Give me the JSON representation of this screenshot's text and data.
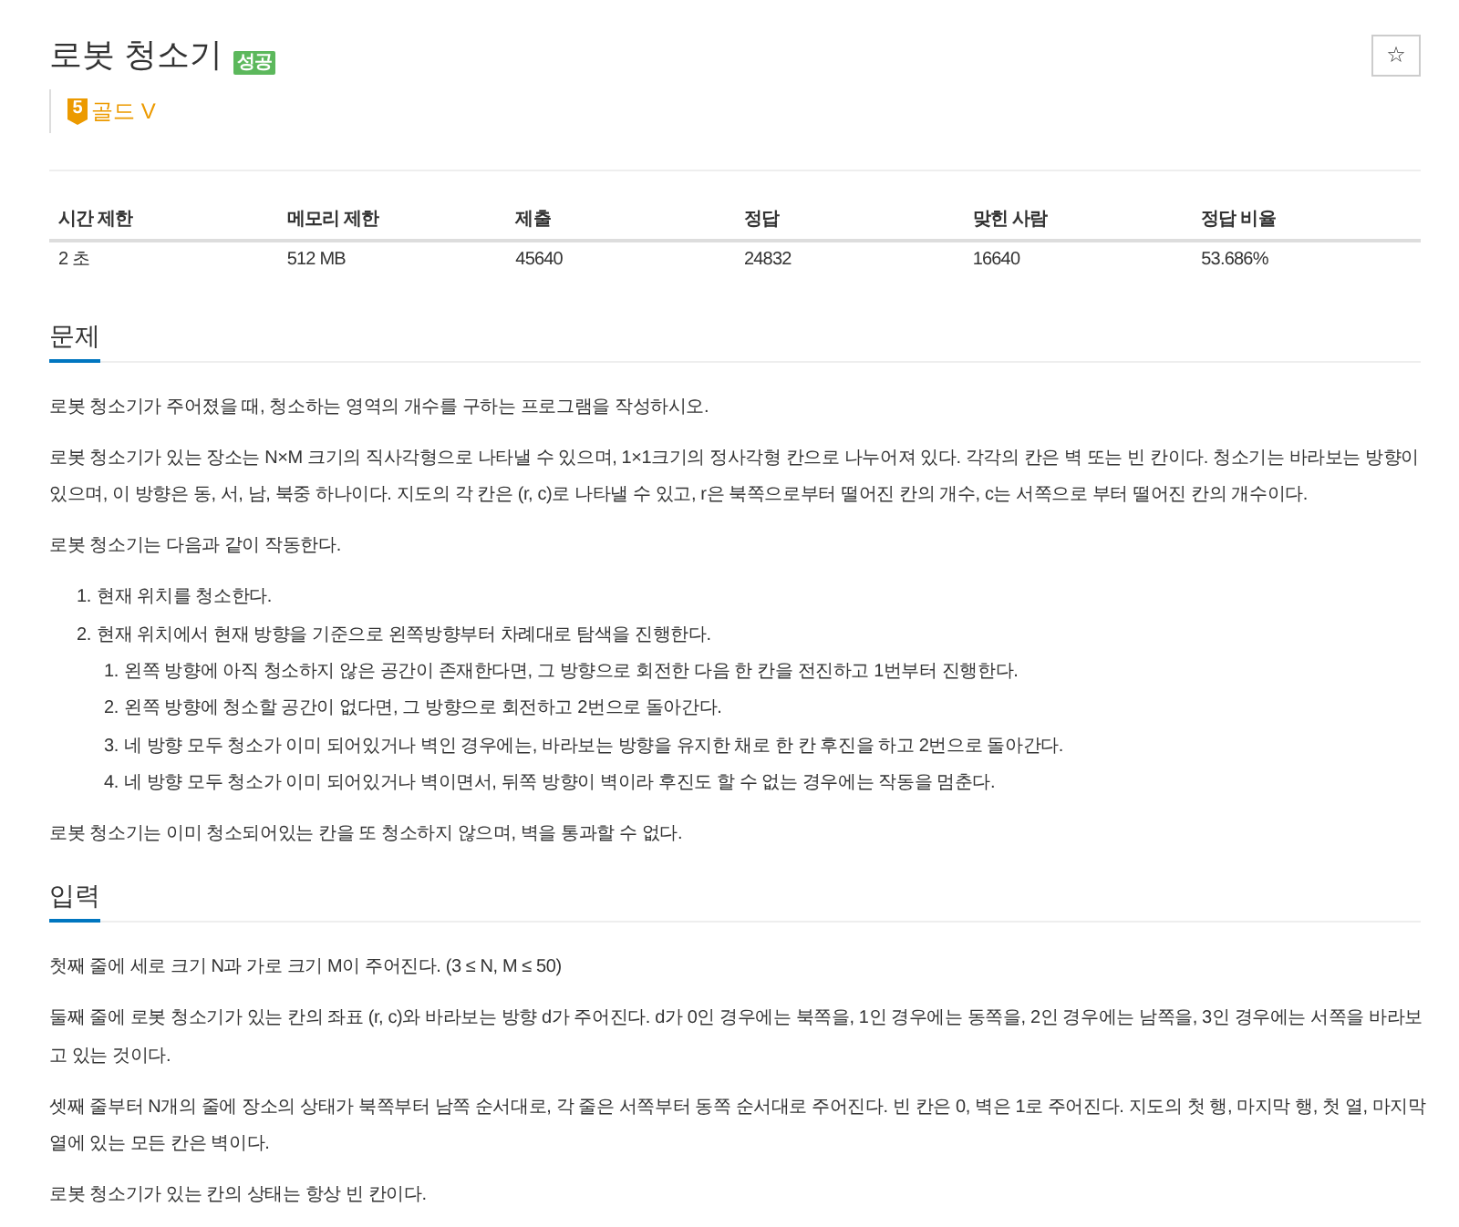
{
  "header": {
    "title": "로봇 청소기",
    "result_badge": "성공",
    "star_button": "☆",
    "tier": {
      "number": "5",
      "name": "골드 V"
    }
  },
  "stats_table": {
    "columns": [
      "시간 제한",
      "메모리 제한",
      "제출",
      "정답",
      "맞힌 사람",
      "정답 비율"
    ],
    "rows": [
      [
        "2 초",
        "512 MB",
        "45640",
        "24832",
        "16640",
        "53.686%"
      ]
    ]
  },
  "sections": [
    {
      "heading": "문제",
      "blocks": [
        {
          "kind": "paragraph",
          "text": "로봇 청소기가 주어졌을 때, 청소하는 영역의 개수를 구하는 프로그램을 작성하시오."
        },
        {
          "kind": "paragraph",
          "text": "로봇 청소기가 있는 장소는 N×M 크기의 직사각형으로 나타낼 수 있으며, 1×1크기의 정사각형 칸으로 나누어져 있다. 각각의 칸은 벽 또는 빈 칸이다. 청소기는 바라보는 방향이 있으며, 이 방향은 동, 서, 남, 북중 하나이다. 지도의 각 칸은 (r, c)로 나타낼 수 있고, r은 북쪽으로부터 떨어진 칸의 개수, c는 서쪽으로 부터 떨어진 칸의 개수이다."
        },
        {
          "kind": "paragraph",
          "text": "로봇 청소기는 다음과 같이 작동한다."
        },
        {
          "kind": "list",
          "items": [
            {
              "number": "1.",
              "text": "현재 위치를 청소한다."
            },
            {
              "number": "2.",
              "text": "현재 위치에서 현재 방향을 기준으로 왼쪽방향부터 차례대로 탐색을 진행한다.",
              "children": [
                {
                  "number": "1.",
                  "text": "왼쪽 방향에 아직 청소하지 않은 공간이 존재한다면, 그 방향으로 회전한 다음 한 칸을 전진하고 1번부터 진행한다."
                },
                {
                  "number": "2.",
                  "text": "왼쪽 방향에 청소할 공간이 없다면, 그 방향으로 회전하고 2번으로 돌아간다."
                },
                {
                  "number": "3.",
                  "text": "네 방향 모두 청소가 이미 되어있거나 벽인 경우에는, 바라보는 방향을 유지한 채로 한 칸 후진을 하고 2번으로 돌아간다."
                },
                {
                  "number": "4.",
                  "text": "네 방향 모두 청소가 이미 되어있거나 벽이면서, 뒤쪽 방향이 벽이라 후진도 할 수 없는 경우에는 작동을 멈춘다."
                }
              ]
            }
          ]
        },
        {
          "kind": "paragraph",
          "text": "로봇 청소기는 이미 청소되어있는 칸을 또 청소하지 않으며, 벽을 통과할 수 없다."
        }
      ]
    },
    {
      "heading": "입력",
      "blocks": [
        {
          "kind": "paragraph",
          "text": "첫째 줄에 세로 크기 N과 가로 크기 M이 주어진다. (3 ≤ N, M ≤ 50)"
        },
        {
          "kind": "paragraph",
          "text": "둘째 줄에 로봇 청소기가 있는 칸의 좌표 (r, c)와 바라보는 방향 d가 주어진다. d가 0인 경우에는 북쪽을, 1인 경우에는 동쪽을, 2인 경우에는 남쪽을, 3인 경우에는 서쪽을 바라보고 있는 것이다."
        },
        {
          "kind": "paragraph",
          "text": "셋째 줄부터 N개의 줄에 장소의 상태가 북쪽부터 남쪽 순서대로, 각 줄은 서쪽부터 동쪽 순서대로 주어진다. 빈 칸은 0, 벽은 1로 주어진다. 지도의 첫 행, 마지막 행, 첫 열, 마지막 열에 있는 모든 칸은 벽이다."
        },
        {
          "kind": "paragraph",
          "text": "로봇 청소기가 있는 칸의 상태는 항상 빈 칸이다."
        }
      ]
    }
  ]
}
